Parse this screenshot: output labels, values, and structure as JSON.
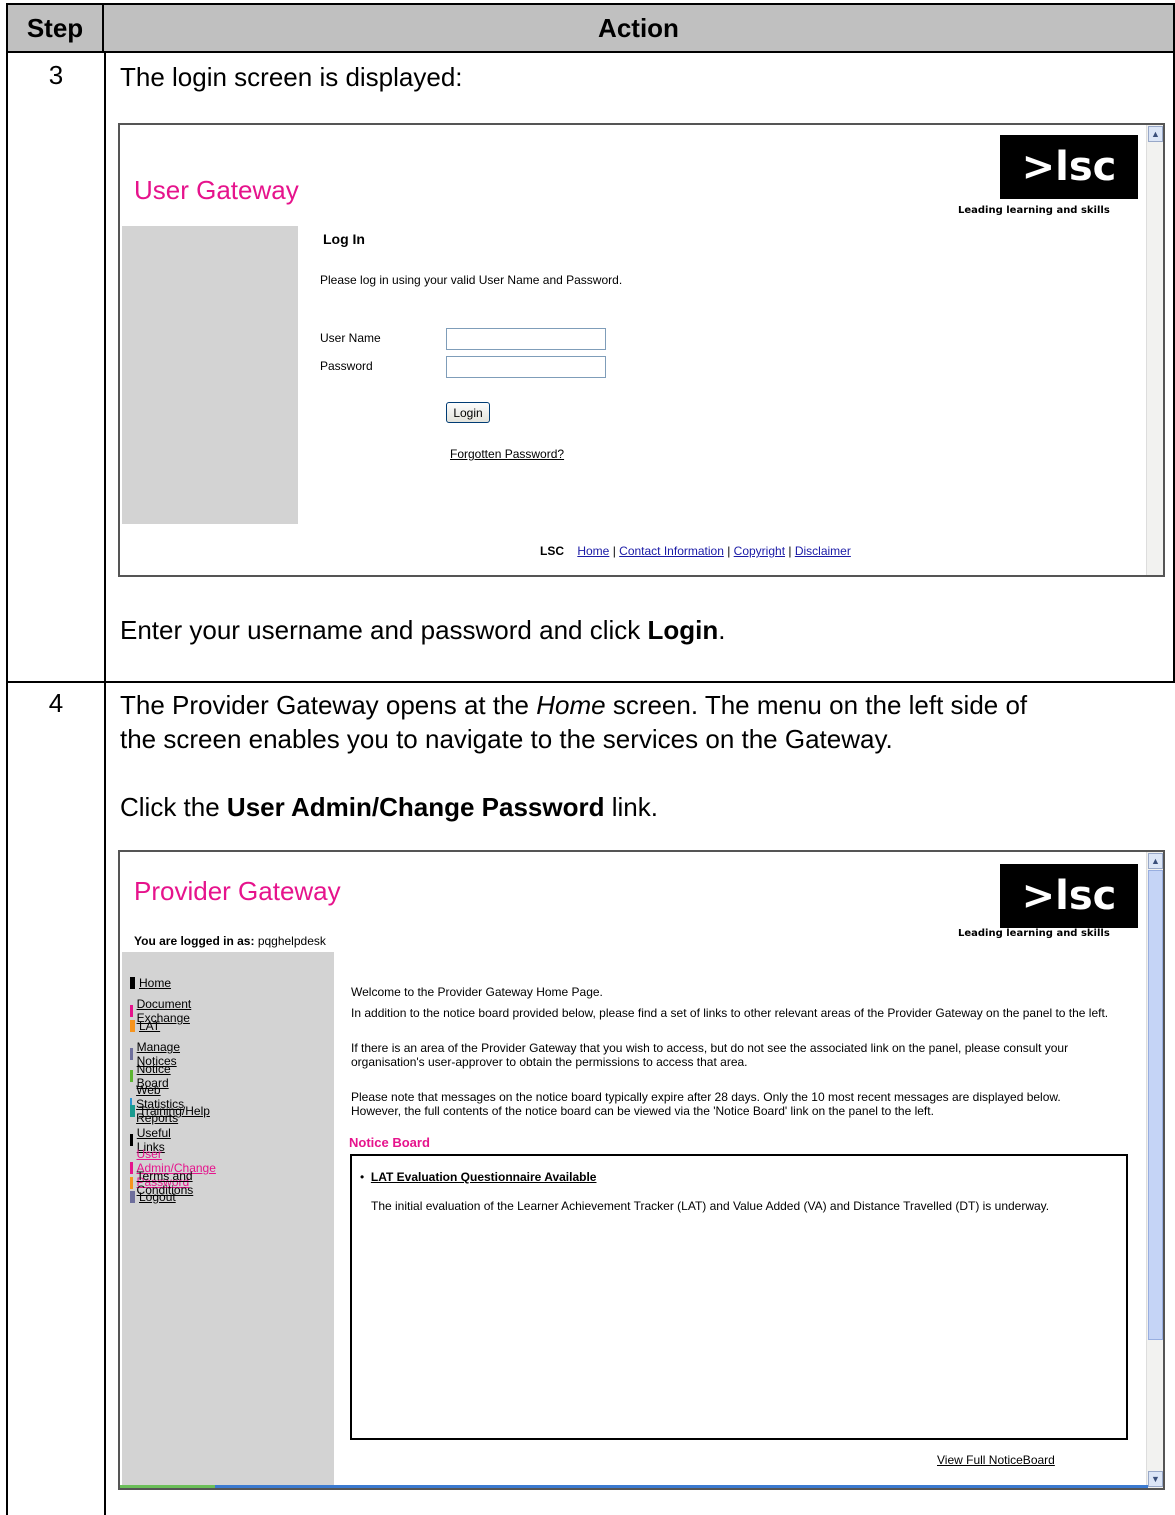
{
  "table": {
    "header_step": "Step",
    "header_action": "Action"
  },
  "step3": {
    "number": "3",
    "intro": "The login screen is displayed:",
    "instruction_pre": "Enter your username and password and click ",
    "instruction_bold": "Login",
    "instruction_post": "."
  },
  "login_screen": {
    "title": "User Gateway",
    "logo_text": ">lsc",
    "logo_tagline": "Leading learning and skills",
    "heading": "Log In",
    "prompt": "Please log in using your valid User Name and Password.",
    "username_label": "User Name",
    "username_value": "",
    "password_label": "Password",
    "password_value": "",
    "login_button": "Login",
    "forgot_link": "Forgotten Password?",
    "footer_brand": "LSC",
    "footer_links": [
      "Home",
      "Contact Information",
      "Copyright",
      "Disclaimer"
    ]
  },
  "step4": {
    "number": "4",
    "intro_pre": "The Provider Gateway opens at the ",
    "intro_italic": "Home",
    "intro_post_line1": " screen. The menu on the left side of",
    "intro_line2": "the screen enables you to navigate to the services on the Gateway.",
    "click_pre": "Click the ",
    "click_bold": "User Admin/Change Password",
    "click_post": " link."
  },
  "provider_screen": {
    "title": "Provider Gateway",
    "logo_text": ">lsc",
    "logo_tagline": "Leading learning and skills",
    "logged_in_label": "You are logged in as:",
    "logged_in_user": "pqghelpdesk",
    "menu": [
      {
        "label": "Home",
        "color": "#000000"
      },
      {
        "label": "Document Exchange",
        "color": "#e6138c"
      },
      {
        "label": "LAT",
        "color": "#f7941d"
      },
      {
        "label": "Manage Notices",
        "color": "#6d6e9c"
      },
      {
        "label": "Notice Board",
        "color": "#5cb531"
      },
      {
        "label": "Web Statistics Reports",
        "color": "#2a94cf"
      },
      {
        "label": "Training/Help",
        "color": "#1a9b8f"
      },
      {
        "label": "Useful Links",
        "color": "#000000"
      },
      {
        "label": "User Admin/Change Password",
        "color": "#e6138c"
      },
      {
        "label": "Terms and Conditions",
        "color": "#f7941d"
      },
      {
        "label": "Logout",
        "color": "#6d6e9c"
      }
    ],
    "welcome": "Welcome to the Provider Gateway Home Page.",
    "para1": "In addition to the notice board provided below, please find a set of links to other relevant areas of the Provider Gateway on the panel to the left.",
    "para2_line1": "If there is an area of the Provider Gateway that you wish to access, but do not see the associated link on the panel, please consult your",
    "para2_line2": "organisation's user-approver to obtain the permissions to access that area.",
    "para3_line1": "Please note that messages on the notice board typically expire after 28 days. Only the 10 most recent messages are displayed below.",
    "para3_line2": "However, the full contents of the notice board can be viewed via the 'Notice Board' link on the panel to the left.",
    "notice_heading": "Notice Board",
    "notice_item_title": "LAT Evaluation Questionnaire Available",
    "notice_item_text": "The initial evaluation of the Learner Achievement Tracker (LAT) and Value Added (VA) and Distance Travelled (DT) is underway.",
    "view_full_link": "View Full NoticeBoard"
  }
}
